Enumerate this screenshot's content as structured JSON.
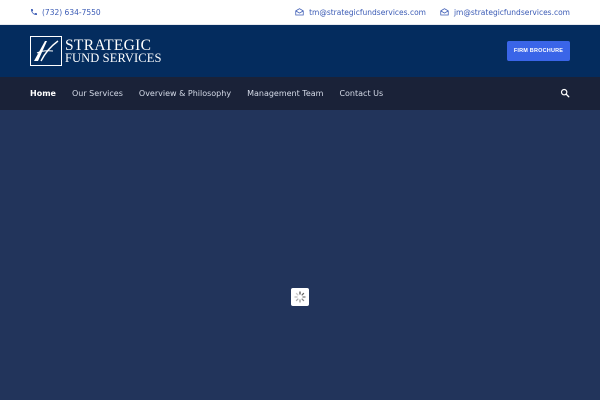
{
  "topbar": {
    "phone": "(732) 634-7550",
    "emails": [
      "tm@strategicfundservices.com",
      "jm@strategicfundservices.com"
    ]
  },
  "header": {
    "logo_line1": "STRATEGIC",
    "logo_line2": "FUND SERVICES",
    "brochure_label": "FIRM BROCHURE"
  },
  "nav": {
    "items": [
      {
        "label": "Home",
        "active": true
      },
      {
        "label": "Our Services",
        "active": false
      },
      {
        "label": "Overview & Philosophy",
        "active": false
      },
      {
        "label": "Management Team",
        "active": false
      },
      {
        "label": "Contact Us",
        "active": false
      }
    ]
  },
  "icons": {
    "phone": "phone-icon",
    "email": "envelope-icon",
    "search": "search-icon",
    "loading": "loading-spinner-icon"
  },
  "colors": {
    "topbar_bg": "#ffffff",
    "header_bg": "#042c5e",
    "nav_bg": "#1a2238",
    "main_bg": "#22345b",
    "accent": "#3a65e8",
    "link": "#3b5bb5"
  }
}
